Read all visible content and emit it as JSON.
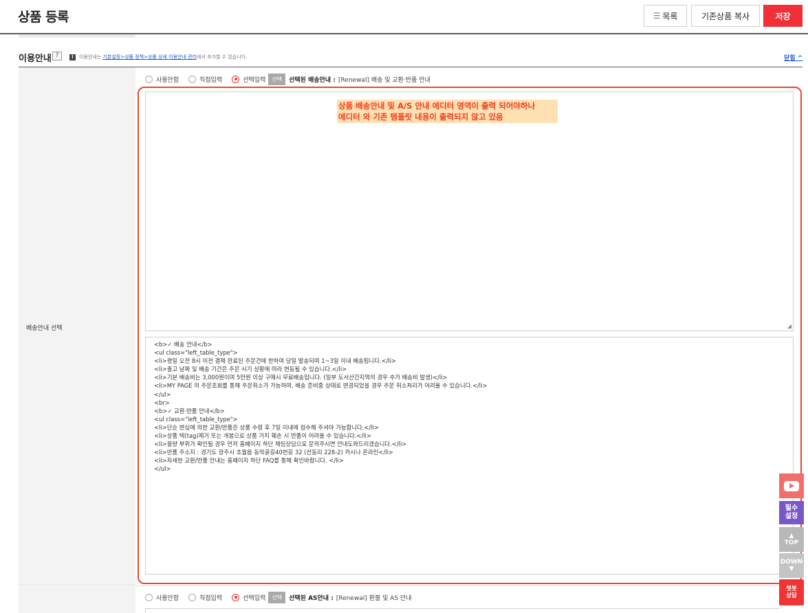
{
  "header": {
    "title": "상품 등록",
    "list_label": "목록",
    "copy_label": "기존상품 복사",
    "save_label": "저장",
    "colors": {
      "save": "#f02f36"
    }
  },
  "usage_section": {
    "title": "이용안내",
    "help": "?",
    "notice_icon": "!",
    "desc_prefix": "이용안내는 ",
    "desc_link": "기본설정>상품 정책>상품 상세 이용안내 관리",
    "desc_suffix": "에서 추가할 수 있습니다.",
    "collapse_label": "닫힘 ^"
  },
  "delivery": {
    "row_label": "배송안내 선택",
    "options": [
      "사용안함",
      "직접입력",
      "선택입력"
    ],
    "selected_index": 2,
    "select_button": "선택",
    "selected_label": "선택된 배송안내 :",
    "selected_value": "[Renewal] 배송 및 교환·반품 안내",
    "annotation_line1": "상품 배송안내 및 A/S 안내 에디터 영역이 출력 되어야하나",
    "annotation_line2": "에디터 와 기존 템플릿 내용이 출력되지 않고 있음",
    "source_lines": [
      "<b>✓ 배송 안내</b>",
      "<ul class=\"left_table_type\">",
      "<li>평일 오전 8시 이전 결제 완료된 주문건에 한하여 당일 발송되며 1~3일 이내 배송됩니다.</li>",
      "<li>출고 날짜 및 배송 기간은 주문 시기 상황에 따라 변동될 수 있습니다.</li>",
      "<li>기본 배송비는 3,000원이며 5만원 이상 구매시 무료배송입니다. (일부 도서산간지역의 경우 추가 배송비 발생)</li>",
      "<li>MY PAGE 의 주문조회를 통해 주문취소가 가능하며, 배송 준비중 상태로 변경되었을 경우 주문 취소처리가 어려울 수 있습니다.</li>",
      "</ul>",
      "<br>",
      "<b>✓ 교환·반품 안내</b>",
      "<ul class=\"left_table_type\">",
      "<li>단순 변심에 의한 교환/반품은 상품 수령 후 7일 이내에 접수해 주셔야 가능합니다.</li>",
      "<li>상품 택(tag)제거 또는 개봉으로 상품 가치 훼손 시 반품이 어려울 수 있습니다.</li>",
      "<li>불량 부위가 확인될 경우 먼저 홈페이지 하단 채팅상담으로 문의주시면 안내도와드리겠습니다.</li>",
      "<li>반품 주소지 : 경기도 광주시 초월읍 동막골길40번길 32 (선동리 228-2) 카시나 온라인</li>",
      "<li>자세한 교환/반품 안내는 홈페이지 하단 FAQ를 통해 확인바랍니다. </li>",
      "</ul>"
    ]
  },
  "as_info": {
    "options": [
      "사용안함",
      "직접입력",
      "선택입력"
    ],
    "selected_index": 2,
    "select_button": "선택",
    "selected_label": "선택된 AS안내 :",
    "selected_value": "[Renewal] 환불 및 AS 안내"
  },
  "floating": {
    "youtube_icon": "youtube-icon",
    "required_line1": "필수",
    "required_line2": "설정",
    "top_label": "TOP",
    "down_label": "DOWN",
    "chat_line1": "챗봇",
    "chat_line2": "상담"
  }
}
